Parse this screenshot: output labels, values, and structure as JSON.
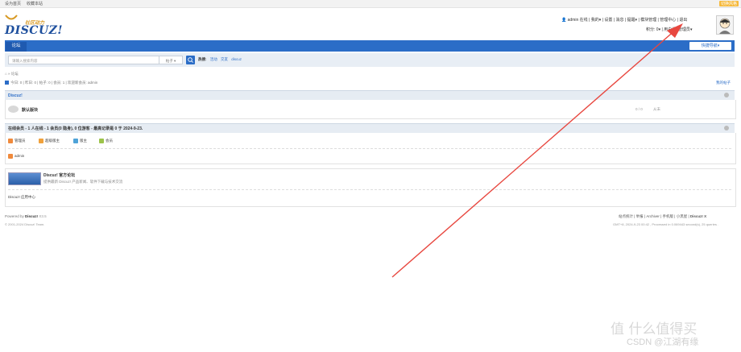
{
  "topbar": {
    "left_links": [
      "设为首页",
      "收藏本站"
    ],
    "right_text": "切换风格"
  },
  "logo": {
    "cn": "社区动力",
    "en": "DISCUZ!"
  },
  "userbar": {
    "row1": [
      "admin",
      "在线",
      "我的",
      "设置",
      "消息",
      "提醒",
      "模块管理",
      "管理中心",
      "退出"
    ],
    "row2": [
      "积分: 0",
      "用户组: 管理员"
    ]
  },
  "nav": {
    "active_tab": "论坛",
    "quick_nav": "快捷导航"
  },
  "search": {
    "placeholder": "请输入搜索内容",
    "type": "帖子",
    "hot_label": "热搜:",
    "hot_words": [
      "活动",
      "交友",
      "discuz"
    ]
  },
  "breadcrumb": [
    "⌂",
    "»",
    "论坛"
  ],
  "stats": "今日: 0 | 昨日: 0 | 帖子: 0 | 会员: 1 | 欢迎新会员: admin",
  "my_posts": "我的帖子",
  "category": {
    "title": "Discuz!",
    "forums": [
      {
        "name": "默认版块",
        "counts": "0 / 0",
        "last": "从未"
      }
    ]
  },
  "online": {
    "title": "在线会员 - 1 人在线 - 1 会员(0 隐身), 0 位游客 - 最高记录是 0 于 2024-9-23.",
    "legend": [
      {
        "label": "管理员",
        "color": "#f08a3c"
      },
      {
        "label": "超级版主",
        "color": "#f0a13c"
      },
      {
        "label": "版主",
        "color": "#4fa3d8"
      },
      {
        "label": "会员",
        "color": "#9cc34a"
      }
    ],
    "users": [
      "admin"
    ]
  },
  "links": {
    "title": "Discuz! 官方论坛",
    "desc": "提供最新 Discuz! 产品新闻、软件下载与技术交流",
    "app_center": "Discuz! 应用中心"
  },
  "footer": {
    "powered": "Powered by",
    "brand": "Discuz!",
    "version": "X3.5",
    "copyright": "© 2001-2024 Discuz! Team.",
    "links": [
      "站点统计",
      "举报",
      "Archiver",
      "手机版",
      "小黑屋",
      "Discuz! X"
    ],
    "gmt": "GMT+8, 2024-9-23 00:42 , Processed in 0.069443 second(s), 25 queries ."
  },
  "watermark": {
    "line1": "值 什么值得买",
    "line2": "CSDN @江湖有缘"
  },
  "colors": {
    "brand_blue": "#2b6dc7",
    "arrow_red": "#e8473f"
  }
}
